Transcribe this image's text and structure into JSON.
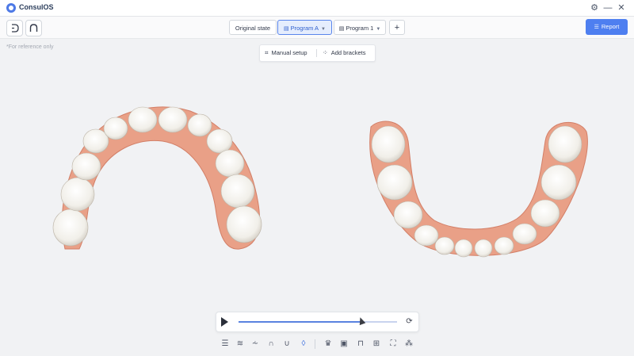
{
  "app": {
    "title": "ConsulOS"
  },
  "window": {
    "settings_icon": "gear-icon",
    "minimize_icon": "minimize-icon",
    "close_icon": "close-icon"
  },
  "toolbar": {
    "left_tools": [
      "undo-icon",
      "arch-icon"
    ],
    "tabs": [
      {
        "label": "Original state",
        "active": false
      },
      {
        "label": "Program A",
        "active": true,
        "icon": "document-icon",
        "has_dropdown": true
      },
      {
        "label": "Program 1",
        "active": false,
        "icon": "document-icon",
        "has_dropdown": true
      }
    ],
    "add_label": "+",
    "report_label": "Report"
  },
  "note": "*For reference only",
  "setup_bar": {
    "manual_label": "Manual setup",
    "brackets_label": "Add brackets"
  },
  "playback": {
    "progress": 0.77
  },
  "bottom_tools": [
    "view-front",
    "view-top",
    "view-bottom",
    "upper-arch",
    "lower-arch",
    "both-arches",
    "tooth-tool",
    "comment-tool",
    "bracket-tool",
    "grid-tool",
    "capture-tool",
    "footprint-tool"
  ],
  "colors": {
    "accent": "#4e7ff0",
    "gum": "#e9a087",
    "tooth": "#f4f1ea"
  }
}
